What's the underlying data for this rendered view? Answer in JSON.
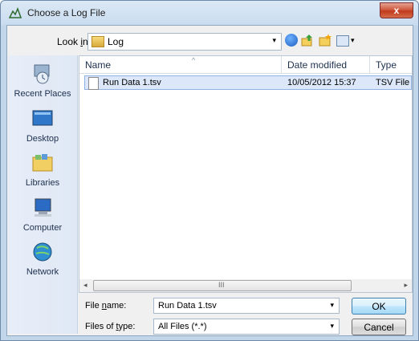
{
  "window": {
    "title": "Choose a Log File",
    "close_label": "x"
  },
  "toolbar": {
    "look_in_label": "Look in:",
    "look_in_value": "Log",
    "dropdown_arrow": "▾"
  },
  "places": [
    {
      "label": "Recent Places",
      "icon": "recent-places-icon"
    },
    {
      "label": "Desktop",
      "icon": "desktop-icon"
    },
    {
      "label": "Libraries",
      "icon": "libraries-icon"
    },
    {
      "label": "Computer",
      "icon": "computer-icon"
    },
    {
      "label": "Network",
      "icon": "network-icon"
    }
  ],
  "columns": {
    "name": "Name",
    "date": "Date modified",
    "type": "Type"
  },
  "files": [
    {
      "name": "Run Data 1.tsv",
      "date": "10/05/2012 15:37",
      "type": "TSV File"
    }
  ],
  "scroll": {
    "left": "◂",
    "right": "▸",
    "grip": "III"
  },
  "bottom": {
    "file_name_label": "File name:",
    "file_name_value": "Run Data 1.tsv",
    "files_of_type_label": "Files of type:",
    "files_of_type_value": "All Files (*.*)",
    "ok_label": "OK",
    "cancel_label": "Cancel"
  }
}
